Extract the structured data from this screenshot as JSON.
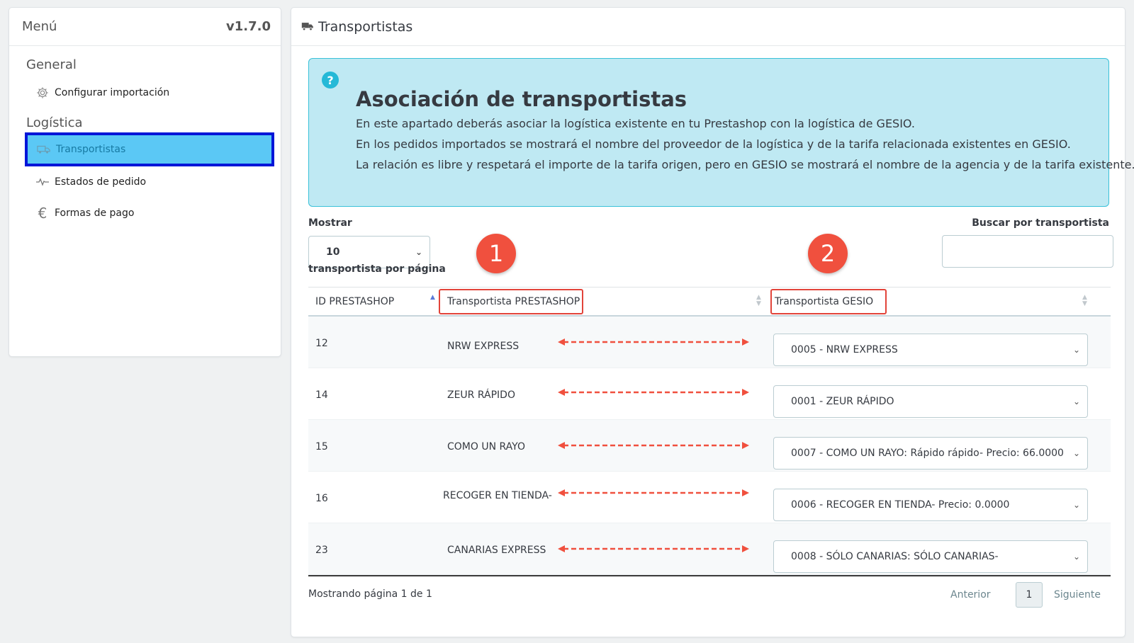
{
  "sidebar": {
    "title": "Menú",
    "version": "v1.7.0",
    "sections": [
      {
        "title": "General",
        "items": [
          {
            "label": "Configurar importación",
            "icon": "gear-icon"
          }
        ]
      },
      {
        "title": "Logística",
        "items": [
          {
            "label": "Transportistas",
            "icon": "truck-icon",
            "active": true
          },
          {
            "label": "Estados de pedido",
            "icon": "pulse-icon"
          },
          {
            "label": "Formas de pago",
            "icon": "euro-icon"
          }
        ]
      }
    ]
  },
  "main": {
    "title": "Transportistas",
    "info": {
      "title": "Asociación de transportistas",
      "lines": [
        "En este apartado deberás asociar la logística existente en tu Prestashop con la logística de GESIO.",
        "En los pedidos importados se mostrará el nombre del proveedor de la logística y de la tarifa relacionada existentes en GESIO.",
        "La relación es libre y respetará el importe de la tarifa origen, pero en GESIO se mostrará el nombre de la agencia y de la tarifa existente."
      ]
    },
    "show_label": "Mostrar",
    "show_value": "10",
    "per_page_label": "transportista por página",
    "search_label": "Buscar por transportista",
    "search_value": "",
    "search_placeholder": "",
    "badges": [
      "1",
      "2"
    ],
    "columns": [
      "ID PRESTASHOP",
      "Transportista PRESTASHOP",
      "Transportista GESIO"
    ],
    "rows": [
      {
        "id": "12",
        "name": "NRW EXPRESS",
        "gesio": "0005 - NRW EXPRESS"
      },
      {
        "id": "14",
        "name": "ZEUR RÁPIDO",
        "gesio": "0001 - ZEUR RÁPIDO"
      },
      {
        "id": "15",
        "name": "COMO UN RAYO",
        "gesio": "0007 - COMO UN RAYO: Rápido rápido- Precio: 66.0000"
      },
      {
        "id": "16",
        "name": "RECOGER EN TIENDA-",
        "gesio": "0006 - RECOGER EN TIENDA- Precio: 0.0000"
      },
      {
        "id": "23",
        "name": "CANARIAS EXPRESS",
        "gesio": "0008 - SÓLO CANARIAS: SÓLO CANARIAS-"
      }
    ],
    "pagination": {
      "info": "Mostrando página 1 de 1",
      "prev": "Anterior",
      "page": "1",
      "next": "Siguiente"
    }
  },
  "colors": {
    "accent": "#25b9d7",
    "highlight_border": "#0016d8",
    "annotation_red": "#f0503e",
    "info_bg": "#bfe9f3"
  }
}
